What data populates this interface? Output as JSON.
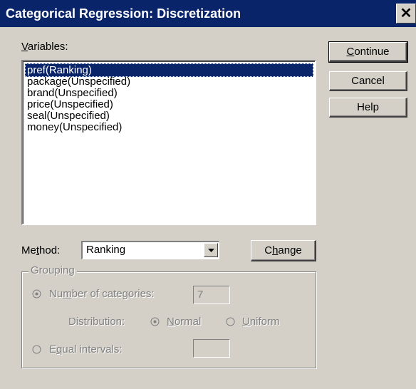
{
  "window": {
    "title": "Categorical Regression: Discretization",
    "close_glyph": "✕"
  },
  "variables": {
    "label": "Variables:",
    "items": [
      "pref(Ranking)",
      "package(Unspecified)",
      "brand(Unspecified)",
      "price(Unspecified)",
      "seal(Unspecified)",
      "money(Unspecified)"
    ],
    "selected_index": 0
  },
  "buttons": {
    "continue": "Continue",
    "cancel": "Cancel",
    "help": "Help",
    "change": "Change"
  },
  "method": {
    "label": "Method:",
    "value": "Ranking"
  },
  "grouping": {
    "legend": "Grouping",
    "number_of_categories_label": "Number of categories:",
    "number_of_categories_value": "7",
    "distribution_label": "Distribution:",
    "normal_label": "Normal",
    "uniform_label": "Uniform",
    "equal_intervals_label": "Equal intervals:",
    "equal_intervals_value": ""
  },
  "colors": {
    "title_bar": "#0a246a",
    "face": "#d4d0c8",
    "selection": "#0a246a",
    "disabled_text": "#808080"
  }
}
